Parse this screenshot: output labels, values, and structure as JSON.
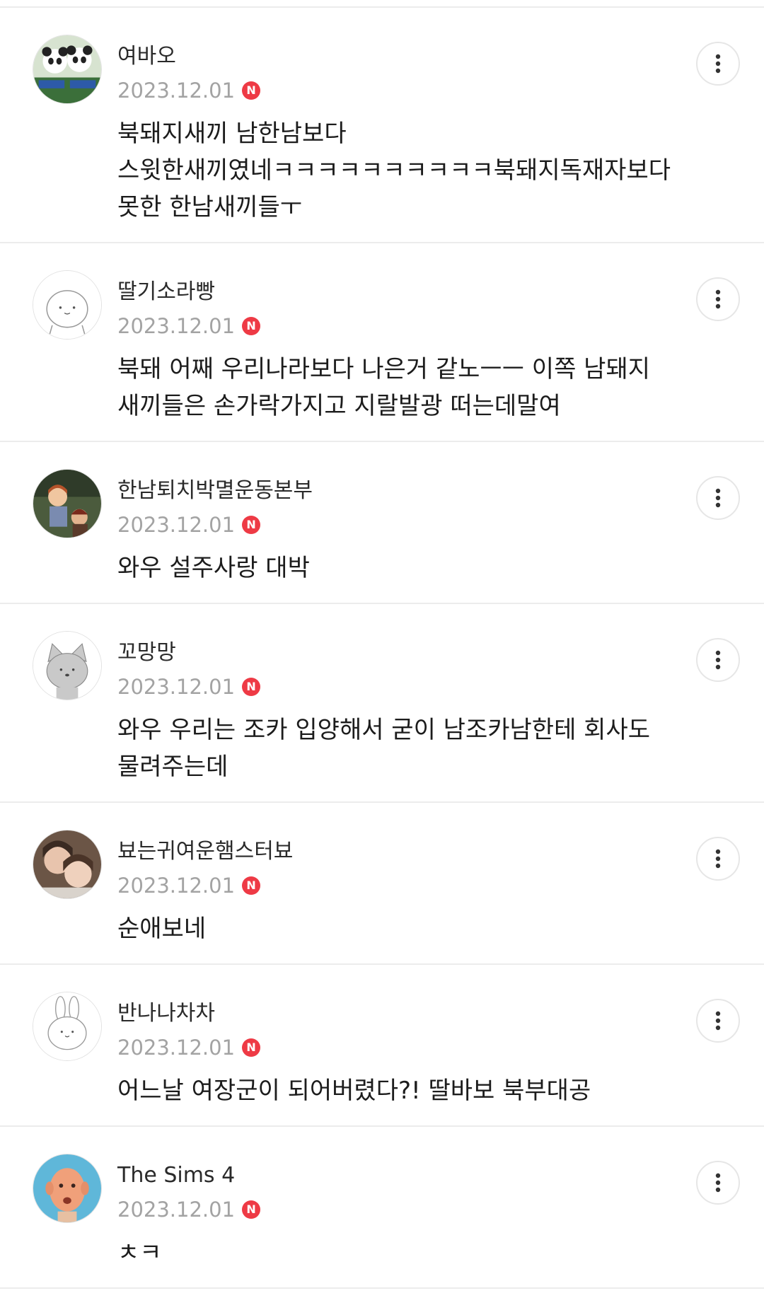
{
  "comments": [
    {
      "nickname": "여바오",
      "date": "2023.12.01",
      "badge": "N",
      "avatar": "panda-avatar",
      "lines": [
        "북돼지새끼 남한남보다",
        "스윗한새끼였네ㅋㅋㅋㅋㅋㅋㅋㅋㅋㅋ북돼지독재자보다",
        "못한 한남새끼들ㅜ"
      ]
    },
    {
      "nickname": "딸기소라빵",
      "date": "2023.12.01",
      "badge": "N",
      "avatar": "default-avatar",
      "lines": [
        "북돼 어째 우리나라보다 나은거 같노ㅡㅡ 이쪽 남돼지",
        "새끼들은 손가락가지고 지랄발광 떠는데말여"
      ]
    },
    {
      "nickname": "한남퇴치박멸운동본부",
      "date": "2023.12.01",
      "badge": "N",
      "avatar": "illustration-avatar",
      "lines": [
        "와우 설주사랑 대박"
      ]
    },
    {
      "nickname": "꼬망망",
      "date": "2023.12.01",
      "badge": "N",
      "avatar": "cat-avatar",
      "lines": [
        "와우 우리는 조카 입양해서 굳이 남조카남한테 회사도",
        "물려주는데"
      ]
    },
    {
      "nickname": "뵤는귀여운햄스터뵤",
      "date": "2023.12.01",
      "badge": "N",
      "avatar": "photo-avatar",
      "lines": [
        "순애보네"
      ]
    },
    {
      "nickname": "반나나차차",
      "date": "2023.12.01",
      "badge": "N",
      "avatar": "rabbit-avatar",
      "lines": [
        "어느날 여장군이 되어버렸다?! 딸바보 북부대공"
      ]
    },
    {
      "nickname": "The Sims 4",
      "date": "2023.12.01",
      "badge": "N",
      "avatar": "sims-avatar",
      "lines": [
        "ㅊㅋ"
      ]
    }
  ],
  "icons": {
    "more": "more-vertical-icon",
    "new": "new-badge"
  },
  "colors": {
    "badge": "#ee3a45",
    "date": "#a3a3a3",
    "divider": "#ececec"
  }
}
